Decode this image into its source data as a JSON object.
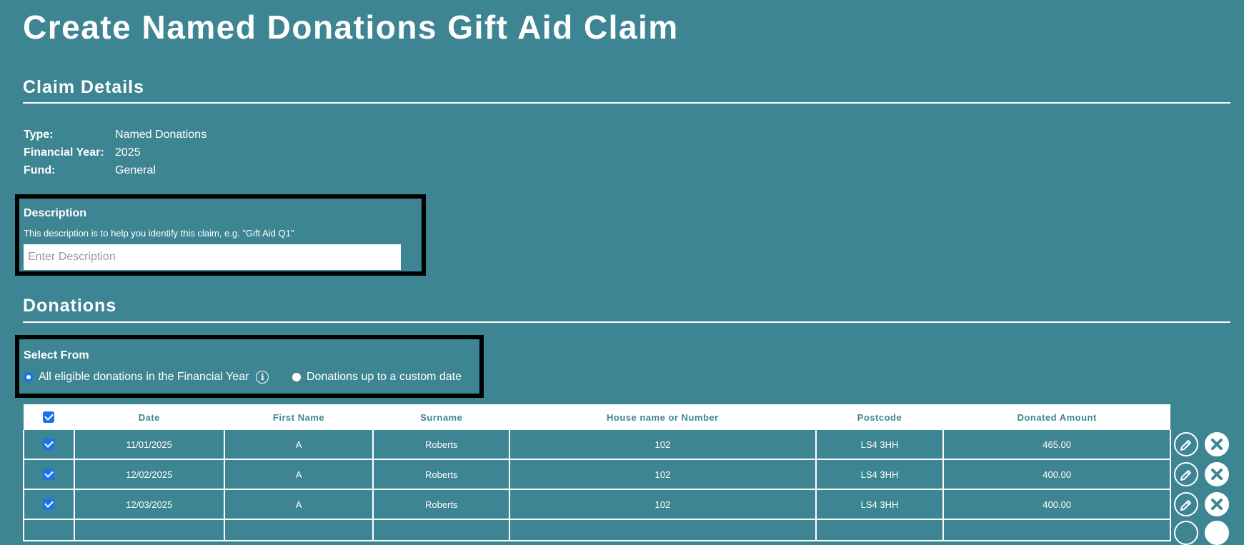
{
  "page": {
    "title": "Create Named Donations Gift Aid Claim"
  },
  "claim_details": {
    "heading": "Claim Details",
    "rows": [
      {
        "label": "Type:",
        "value": "Named Donations"
      },
      {
        "label": "Financial Year:",
        "value": "2025"
      },
      {
        "label": "Fund:",
        "value": "General"
      }
    ]
  },
  "description": {
    "heading": "Description",
    "help": "This description is to help you identify this claim, e.g. \"Gift Aid Q1\"",
    "placeholder": "Enter Description",
    "value": ""
  },
  "donations": {
    "heading": "Donations",
    "select_from": {
      "heading": "Select From",
      "options": [
        {
          "label": "All eligible donations in the Financial Year",
          "selected": true,
          "icon": "info-icon"
        },
        {
          "label": "Donations up to a custom date",
          "selected": false
        }
      ]
    },
    "table": {
      "header_checkbox_checked": true,
      "columns": [
        "Date",
        "First Name",
        "Surname",
        "House name or Number",
        "Postcode",
        "Donated Amount"
      ],
      "rows": [
        {
          "checked": true,
          "cells": [
            "11/01/2025",
            "A",
            "Roberts",
            "102",
            "LS4 3HH",
            "465.00"
          ]
        },
        {
          "checked": true,
          "cells": [
            "12/02/2025",
            "A",
            "Roberts",
            "102",
            "LS4 3HH",
            "400.00"
          ]
        },
        {
          "checked": true,
          "cells": [
            "12/03/2025",
            "A",
            "Roberts",
            "102",
            "LS4 3HH",
            "400.00"
          ]
        }
      ],
      "row_action_icons": [
        "edit-icon",
        "delete-icon"
      ]
    }
  },
  "colors": {
    "background": "#3e8593",
    "checkbox": "#1a73e8",
    "box_border": "#000000"
  }
}
